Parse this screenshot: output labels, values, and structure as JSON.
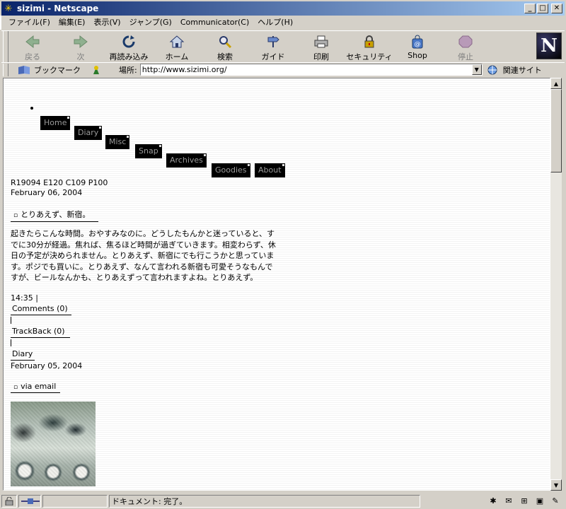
{
  "window": {
    "title": "sizimi - Netscape"
  },
  "menu": [
    "ファイル(F)",
    "編集(E)",
    "表示(V)",
    "ジャンプ(G)",
    "Communicator(C)",
    "ヘルプ(H)"
  ],
  "toolbar": {
    "back": "戻る",
    "forward": "次",
    "reload": "再読み込み",
    "home": "ホーム",
    "search": "検索",
    "guide": "ガイド",
    "print": "印刷",
    "security": "セキュリティ",
    "shop": "Shop",
    "stop": "停止"
  },
  "location": {
    "bookmarks": "ブックマーク",
    "label": "場所:",
    "url": "http://www.sizimi.org/",
    "related": "関連サイト"
  },
  "nav": [
    "Home",
    "Diary",
    "Misc",
    "Snap",
    "Archives",
    "Goodies",
    "About"
  ],
  "stats": "R19094 E120 C109 P100",
  "entries": [
    {
      "date": "February 06, 2004",
      "title": "とりあえず、新宿。",
      "body": "起きたらこんな時間。おやすみなのに。どうしたもんかと迷っていると、すでに30分が経過。焦れば、焦るほど時間が過ぎていきます。相変わらず、休日の予定が決められません。とりあえず、新宿にでも行こうかと思っています。ポジでも買いに。とりあえず、なんて言われる新宿も可愛そうなもんですが、ビールなんかも、とりあえずって言われますよね。とりあえず。",
      "time": "14:35 |",
      "comments": "Comments (0)",
      "trackback": "TrackBack (0)",
      "category": "Diary"
    },
    {
      "date": "February 05, 2004",
      "title": "via email"
    }
  ],
  "status": {
    "text": "ドキュメント: 完了。"
  }
}
